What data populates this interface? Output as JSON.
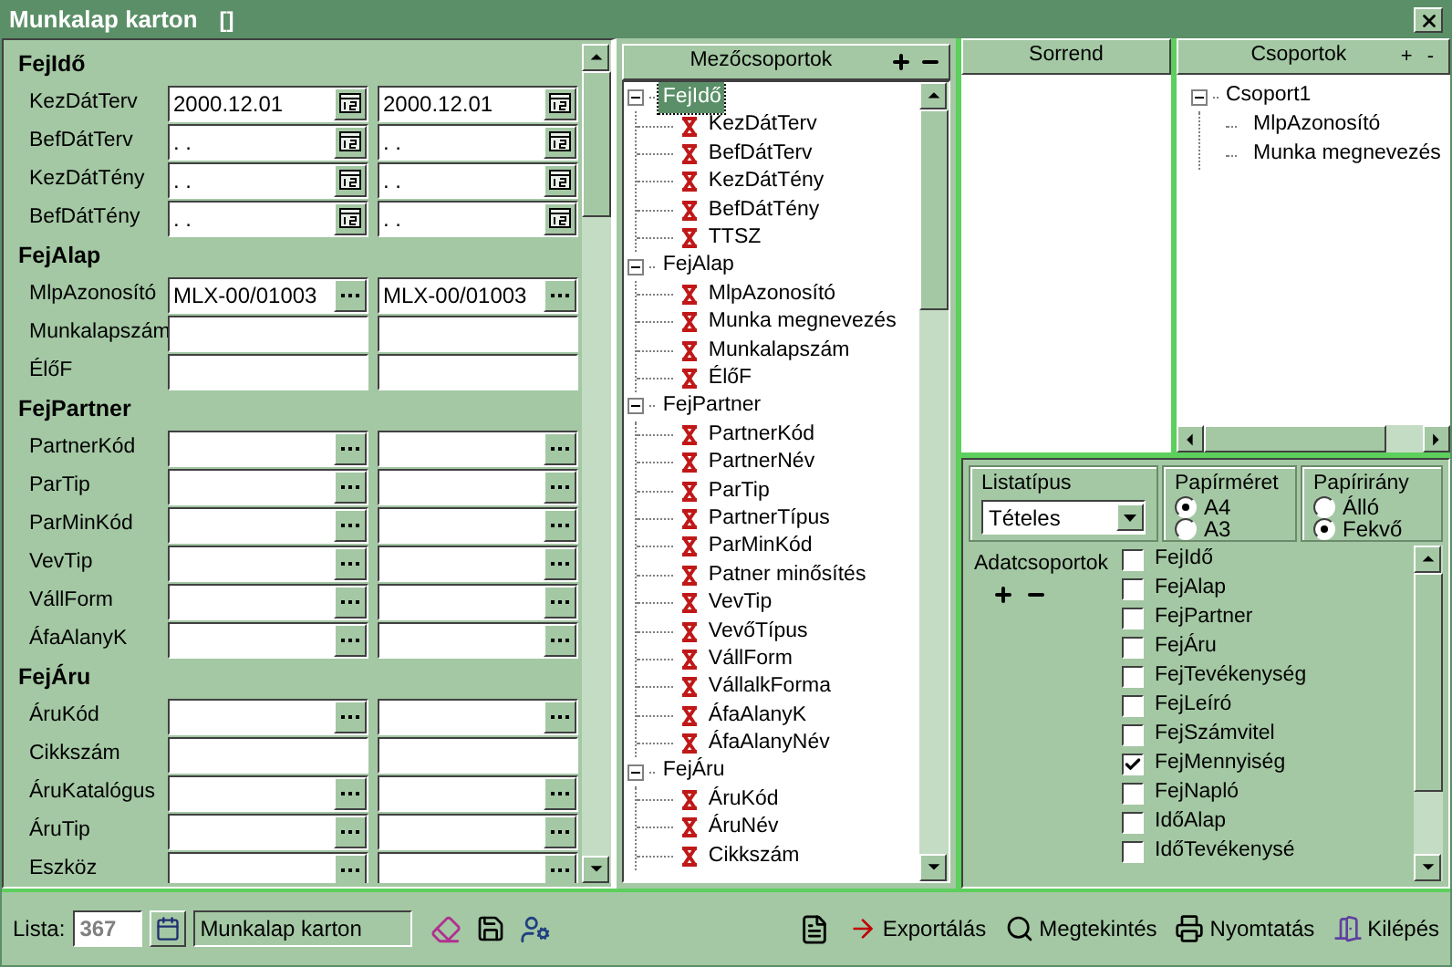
{
  "window": {
    "title": "Munkalap karton",
    "title_mark": "[]"
  },
  "form": {
    "sections": [
      {
        "title": "FejIdő",
        "fields": [
          {
            "label": "KezDátTerv",
            "kind": "date",
            "from": "2000.12.01",
            "to": "2000.12.01"
          },
          {
            "label": "BefDátTerv",
            "kind": "date",
            "from": ". .",
            "to": ". ."
          },
          {
            "label": "KezDátTény",
            "kind": "date",
            "from": ". .",
            "to": ". ."
          },
          {
            "label": "BefDátTény",
            "kind": "date",
            "from": ". .",
            "to": ". ."
          }
        ]
      },
      {
        "title": "FejAlap",
        "fields": [
          {
            "label": "MlpAzonosító",
            "kind": "lookup",
            "from": "MLX-00/01003",
            "to": "MLX-00/01003"
          },
          {
            "label": "Munkalapszám",
            "kind": "text"
          },
          {
            "label": "ÉlőF",
            "kind": "text"
          }
        ]
      },
      {
        "title": "FejPartner",
        "fields": [
          {
            "label": "PartnerKód",
            "kind": "lookup"
          },
          {
            "label": "ParTip",
            "kind": "lookup"
          },
          {
            "label": "ParMinKód",
            "kind": "lookup"
          },
          {
            "label": "VevTip",
            "kind": "lookup"
          },
          {
            "label": "VállForm",
            "kind": "lookup"
          },
          {
            "label": "ÁfaAlanyK",
            "kind": "lookup"
          }
        ]
      },
      {
        "title": "FejÁru",
        "fields": [
          {
            "label": "ÁruKód",
            "kind": "lookup"
          },
          {
            "label": "Cikkszám",
            "kind": "text"
          },
          {
            "label": "ÁruKatalógus",
            "kind": "lookup"
          },
          {
            "label": "ÁruTip",
            "kind": "lookup"
          },
          {
            "label": "Eszköz",
            "kind": "lookup"
          }
        ]
      }
    ]
  },
  "field_groups": {
    "title": "Mezőcsoportok",
    "tree": [
      {
        "label": "FejIdő",
        "selected": true,
        "expanded": true,
        "children": [
          {
            "label": "KezDátTerv"
          },
          {
            "label": "BefDátTerv"
          },
          {
            "label": "KezDátTény"
          },
          {
            "label": "BefDátTény"
          },
          {
            "label": "TTSZ"
          }
        ]
      },
      {
        "label": "FejAlap",
        "selected": false,
        "expanded": true,
        "children": [
          {
            "label": "MlpAzonosító"
          },
          {
            "label": "Munka megnevezés"
          },
          {
            "label": "Munkalapszám"
          },
          {
            "label": "ÉlőF"
          }
        ]
      },
      {
        "label": "FejPartner",
        "selected": false,
        "expanded": true,
        "children": [
          {
            "label": "PartnerKód"
          },
          {
            "label": "PartnerNév"
          },
          {
            "label": "ParTip"
          },
          {
            "label": "PartnerTípus"
          },
          {
            "label": "ParMinKód"
          },
          {
            "label": "Patner minősítés"
          },
          {
            "label": "VevTip"
          },
          {
            "label": "VevőTípus"
          },
          {
            "label": "VállForm"
          },
          {
            "label": "VállalkForma"
          },
          {
            "label": "ÁfaAlanyK"
          },
          {
            "label": "ÁfaAlanyNév"
          }
        ]
      },
      {
        "label": "FejÁru",
        "selected": false,
        "expanded": true,
        "children": [
          {
            "label": "ÁruKód"
          },
          {
            "label": "ÁruNév"
          },
          {
            "label": "Cikkszám"
          }
        ]
      }
    ]
  },
  "order": {
    "title": "Sorrend"
  },
  "groups": {
    "title": "Csoportok",
    "add": "+",
    "remove": "-",
    "tree": [
      {
        "label": "Csoport1",
        "selected": false,
        "expanded": true,
        "children": [
          {
            "label": "MlpAzonosító"
          },
          {
            "label": "Munka megnevezés"
          }
        ]
      }
    ]
  },
  "options": {
    "list_type": {
      "label": "Listatípus",
      "value": "Tételes"
    },
    "paper_size": {
      "label": "Papírméret",
      "options": [
        {
          "label": "A4",
          "selected": true
        },
        {
          "label": "A3",
          "selected": false
        }
      ]
    },
    "orientation": {
      "label": "Papírirány",
      "options": [
        {
          "label": "Álló",
          "selected": false
        },
        {
          "label": "Fekvő",
          "selected": true
        }
      ]
    },
    "data_groups": {
      "label": "Adatcsoportok",
      "items": [
        {
          "label": "FejIdő",
          "checked": false
        },
        {
          "label": "FejAlap",
          "checked": false
        },
        {
          "label": "FejPartner",
          "checked": false
        },
        {
          "label": "FejÁru",
          "checked": false
        },
        {
          "label": "FejTevékenység",
          "checked": false
        },
        {
          "label": "FejLeíró",
          "checked": false
        },
        {
          "label": "FejSzámvitel",
          "checked": false
        },
        {
          "label": "FejMennyiség",
          "checked": true
        },
        {
          "label": "FejNapló",
          "checked": false
        },
        {
          "label": "IdőAlap",
          "checked": false
        },
        {
          "label": "IdőTevékenysé",
          "checked": false
        }
      ]
    }
  },
  "footer": {
    "list_label": "Lista:",
    "list_value": "367",
    "list_name": "Munkalap karton",
    "buttons": [
      {
        "label": "Exportálás",
        "kind": "export"
      },
      {
        "label": "Megtekintés",
        "kind": "preview"
      },
      {
        "label": "Nyomtatás",
        "kind": "print"
      },
      {
        "label": "Kilépés",
        "kind": "exit"
      }
    ]
  }
}
